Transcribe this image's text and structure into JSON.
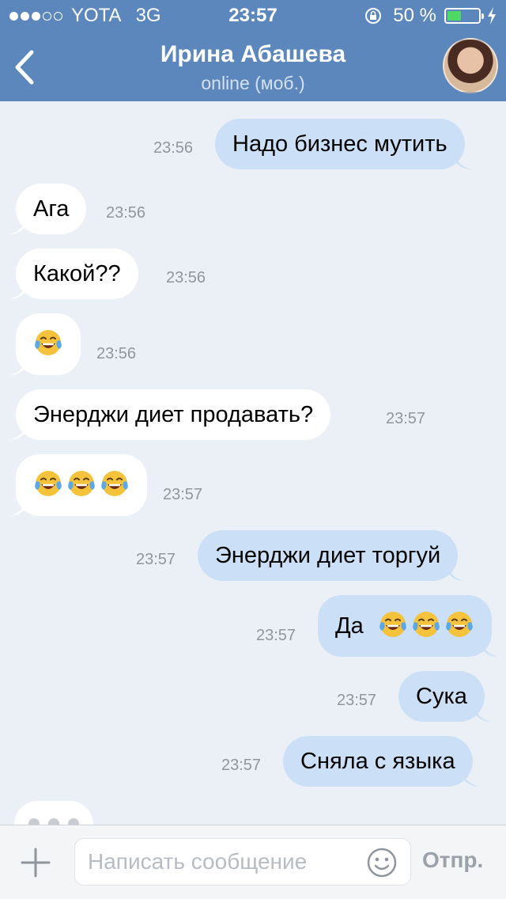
{
  "status_bar": {
    "carrier": "YOTA",
    "network": "3G",
    "time": "23:57",
    "battery_percent_label": "50 %",
    "battery_level": 0.5,
    "signal_bars_filled": 3,
    "signal_bars_total": 5
  },
  "header": {
    "back_icon": "chevron-left-icon",
    "contact_name": "Ирина Абашева",
    "contact_status": "online (моб.)"
  },
  "messages": [
    {
      "direction": "out",
      "text": "Надо бизнес мутить",
      "time": "23:56"
    },
    {
      "direction": "in",
      "text": "Ага",
      "time": "23:56"
    },
    {
      "direction": "in",
      "text": "Какой??",
      "time": "23:56"
    },
    {
      "direction": "in",
      "text": "",
      "emoji_count": 1,
      "time": "23:56"
    },
    {
      "direction": "in",
      "text": "Энерджи диет продавать?",
      "time": "23:57"
    },
    {
      "direction": "in",
      "text": "",
      "emoji_count": 3,
      "time": "23:57"
    },
    {
      "direction": "out",
      "text": "Энерджи диет торгуй",
      "time": "23:57"
    },
    {
      "direction": "out",
      "text": "Да",
      "emoji_count": 3,
      "time": "23:57"
    },
    {
      "direction": "out",
      "text": "Сука",
      "time": "23:57"
    },
    {
      "direction": "out",
      "text": "Сняла с языка",
      "time": "23:57"
    }
  ],
  "composer": {
    "placeholder": "Написать сообщение",
    "send_label": "Отпр.",
    "attach_icon": "plus-icon",
    "emoji_icon": "smile-icon"
  },
  "colors": {
    "header_bg": "#5b87bd",
    "chat_bg": "#ebf0f6",
    "incoming_bubble": "#ffffff",
    "outgoing_bubble": "#cbdff6"
  }
}
